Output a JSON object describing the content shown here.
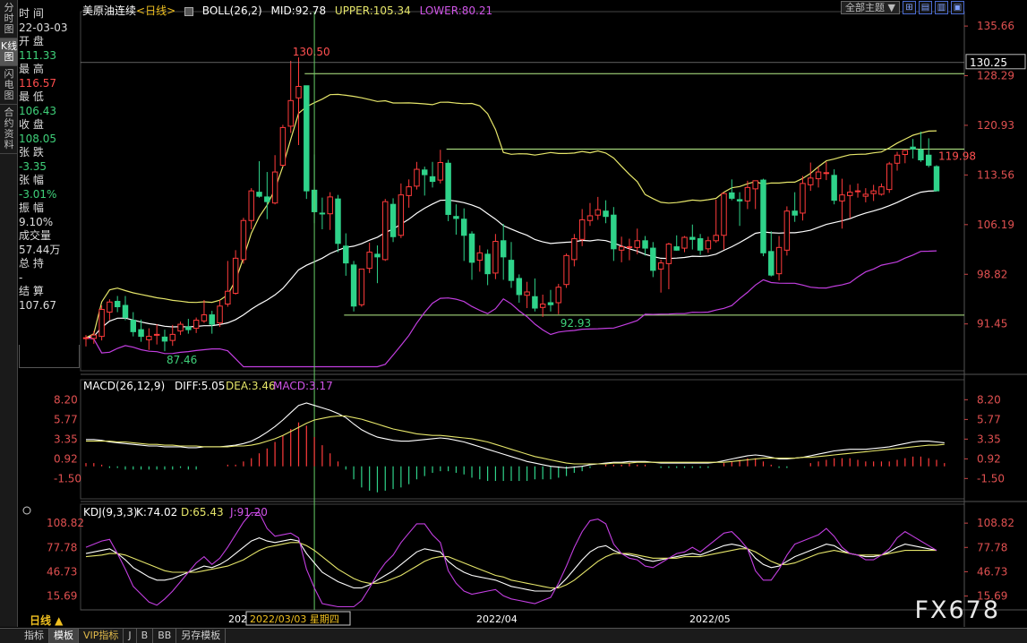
{
  "side_tabs": [
    "分时图",
    "K线图",
    "闪电图",
    "合约资料"
  ],
  "side_active": 1,
  "info_panel": [
    {
      "label": "时 间",
      "value": "22-03-03",
      "color": "white"
    },
    {
      "label": "开 盘",
      "value": "111.33",
      "color": "green"
    },
    {
      "label": "最 高",
      "value": "116.57",
      "color": "red"
    },
    {
      "label": "最 低",
      "value": "106.43",
      "color": "green"
    },
    {
      "label": "收 盘",
      "value": "108.05",
      "color": "green"
    },
    {
      "label": "张 跌",
      "value": "-3.35",
      "color": "green"
    },
    {
      "label": "张 幅",
      "value": "-3.01%",
      "color": "green"
    },
    {
      "label": "振 幅",
      "value": "9.10%",
      "color": "white"
    },
    {
      "label": "成交量",
      "value": "57.44万",
      "color": "white"
    },
    {
      "label": "总 持",
      "value": "-",
      "color": "white"
    },
    {
      "label": "结 算",
      "value": "107.67",
      "color": "white"
    }
  ],
  "header": {
    "symbol": "美原油连续",
    "period_tag": "<日线>",
    "boll_label": "BOLL(26,2)",
    "mid": "MID:92.78",
    "upper": "UPPER:105.34",
    "lower": "LOWER:80.21"
  },
  "toolbar": {
    "theme": "全部主题",
    "icons": [
      "⊞",
      "▤",
      "▥",
      "▣"
    ]
  },
  "macd_header": {
    "name": "MACD(26,12,9)",
    "diff": "DIFF:5.05",
    "dea": "DEA:3.46",
    "macd": "MACD:3.17"
  },
  "kdj_header": {
    "name": "KDJ(9,3,3)",
    "k": "K:74.02",
    "d": "D:65.43",
    "j": "J:91.20"
  },
  "period_button": "日线 ▲",
  "date_axis": {
    "left": "202",
    "cursor": "2022/03/03 星期四",
    "apr": "2022/04",
    "may": "2022/05"
  },
  "bottom_tabs": [
    "指标",
    "模板",
    "VIP指标",
    "J",
    "B",
    "BB",
    "另存模板"
  ],
  "bottom_active": 1,
  "watermark": "FX678",
  "colors": {
    "up": "#ff3b3b",
    "down": "#2fd38a",
    "mid": "#ffffff",
    "upper": "#e6e66a",
    "lower": "#c23ee0",
    "crosshair": "#66cc66"
  },
  "chart_data": [
    {
      "type": "candlestick",
      "title": "美原油连续 日线",
      "y_ticks": [
        135.66,
        128.29,
        120.93,
        113.56,
        106.19,
        98.82,
        91.45
      ],
      "ylim": [
        84.5,
        137.8
      ],
      "price_tag": "130.25",
      "annotations": [
        {
          "text": "130.50",
          "bar": 26
        },
        {
          "text": "87.46",
          "bar": 10
        },
        {
          "text": "92.93",
          "bar": 60
        },
        {
          "text": "119.98",
          "bar": 108
        }
      ],
      "horizontal_lines": [
        {
          "y": 128.6,
          "from_bar": 28
        },
        {
          "y": 117.4,
          "from_bar": 46
        },
        {
          "y": 92.75,
          "from_bar": 33
        }
      ],
      "ohlc": [
        [
          89.4,
          89.8,
          88.1,
          89.4
        ],
        [
          89.3,
          90.4,
          88.5,
          89.8
        ],
        [
          89.6,
          94.2,
          89.0,
          93.6
        ],
        [
          93.2,
          95.1,
          92.0,
          94.7
        ],
        [
          94.8,
          95.6,
          93.2,
          94.0
        ],
        [
          94.2,
          95.6,
          92.0,
          92.4
        ],
        [
          92.0,
          93.2,
          89.6,
          90.3
        ],
        [
          90.6,
          92.1,
          88.8,
          89.6
        ],
        [
          89.1,
          90.8,
          87.6,
          89.6
        ],
        [
          89.9,
          91.4,
          88.4,
          89.9
        ],
        [
          89.5,
          90.6,
          87.4,
          88.9
        ],
        [
          89.0,
          91.3,
          88.2,
          89.9
        ],
        [
          90.4,
          91.8,
          89.8,
          91.4
        ],
        [
          91.0,
          92.2,
          90.0,
          90.6
        ],
        [
          90.8,
          92.4,
          90.1,
          92.0
        ],
        [
          91.9,
          95.0,
          91.6,
          92.8
        ],
        [
          92.8,
          93.4,
          90.0,
          91.4
        ],
        [
          91.6,
          95.0,
          91.0,
          94.1
        ],
        [
          94.4,
          100.8,
          94.0,
          96.3
        ],
        [
          96.0,
          102.4,
          95.8,
          101.2
        ],
        [
          101.0,
          107.2,
          100.4,
          106.8
        ],
        [
          106.8,
          111.6,
          105.5,
          111.2
        ],
        [
          111.0,
          115.6,
          110.2,
          110.4
        ],
        [
          110.3,
          114.0,
          107.0,
          109.6
        ],
        [
          109.4,
          116.5,
          109.2,
          114.0
        ],
        [
          115.0,
          121.0,
          114.8,
          120.6
        ],
        [
          120.8,
          130.5,
          119.8,
          124.6
        ],
        [
          125.0,
          131.0,
          118.0,
          126.7
        ],
        [
          126.8,
          126.8,
          110.0,
          111.2
        ],
        [
          111.3,
          116.6,
          106.4,
          108.1
        ],
        [
          107.9,
          110.2,
          105.5,
          107.8
        ],
        [
          107.8,
          111.0,
          105.4,
          110.3
        ],
        [
          110.0,
          110.6,
          102.1,
          103.4
        ],
        [
          103.0,
          104.9,
          98.6,
          100.5
        ],
        [
          100.2,
          100.8,
          93.3,
          94.1
        ],
        [
          94.3,
          99.6,
          94.0,
          99.6
        ],
        [
          99.7,
          103.5,
          99.0,
          102.1
        ],
        [
          101.8,
          103.1,
          97.5,
          101.4
        ],
        [
          101.0,
          110.0,
          100.8,
          109.6
        ],
        [
          109.2,
          110.1,
          103.6,
          104.4
        ],
        [
          104.6,
          112.3,
          104.2,
          110.6
        ],
        [
          110.5,
          112.9,
          108.7,
          111.8
        ],
        [
          111.9,
          115.5,
          111.4,
          114.4
        ],
        [
          114.3,
          114.8,
          110.5,
          113.6
        ],
        [
          113.3,
          115.5,
          111.7,
          112.6
        ],
        [
          112.8,
          117.3,
          112.3,
          115.4
        ],
        [
          115.3,
          115.8,
          106.7,
          107.7
        ],
        [
          107.4,
          109.2,
          104.7,
          107.1
        ],
        [
          107.0,
          108.6,
          100.8,
          104.6
        ],
        [
          104.8,
          105.2,
          98.0,
          100.6
        ],
        [
          100.9,
          103.1,
          99.2,
          102.0
        ],
        [
          101.8,
          102.5,
          97.2,
          98.9
        ],
        [
          99.0,
          104.8,
          98.1,
          103.7
        ],
        [
          103.8,
          106.3,
          98.0,
          101.4
        ],
        [
          100.9,
          103.6,
          96.8,
          97.9
        ],
        [
          98.2,
          98.8,
          94.6,
          95.8
        ],
        [
          95.7,
          97.7,
          93.8,
          96.2
        ],
        [
          95.5,
          98.2,
          93.3,
          93.8
        ],
        [
          93.9,
          95.8,
          92.5,
          94.4
        ],
        [
          94.6,
          96.5,
          93.3,
          94.3
        ],
        [
          94.6,
          97.4,
          92.9,
          96.9
        ],
        [
          97.3,
          101.9,
          96.8,
          101.6
        ],
        [
          101.0,
          104.8,
          100.0,
          104.1
        ],
        [
          104.0,
          108.5,
          103.0,
          106.9
        ],
        [
          106.8,
          109.4,
          106.0,
          107.5
        ],
        [
          107.6,
          110.3,
          106.9,
          108.4
        ],
        [
          108.2,
          109.8,
          106.4,
          107.4
        ],
        [
          107.6,
          108.8,
          100.8,
          102.6
        ],
        [
          102.4,
          104.4,
          100.6,
          102.9
        ],
        [
          102.8,
          104.1,
          100.9,
          102.9
        ],
        [
          102.8,
          105.6,
          101.8,
          103.8
        ],
        [
          103.8,
          104.5,
          101.6,
          102.7
        ],
        [
          102.7,
          103.6,
          98.4,
          99.4
        ],
        [
          99.6,
          101.0,
          96.1,
          100.5
        ],
        [
          100.4,
          103.5,
          96.6,
          103.3
        ],
        [
          102.9,
          104.6,
          102.3,
          102.4
        ],
        [
          102.7,
          104.5,
          102.1,
          104.3
        ],
        [
          104.3,
          106.2,
          102.5,
          104.0
        ],
        [
          104.1,
          104.8,
          101.7,
          102.4
        ],
        [
          102.6,
          104.4,
          102.0,
          103.8
        ],
        [
          103.8,
          109.9,
          103.5,
          104.6
        ],
        [
          104.6,
          111.0,
          102.5,
          110.8
        ],
        [
          110.9,
          112.9,
          109.8,
          110.1
        ],
        [
          109.9,
          111.0,
          106.0,
          109.7
        ],
        [
          109.7,
          112.7,
          108.5,
          111.7
        ],
        [
          111.5,
          112.7,
          108.5,
          112.7
        ],
        [
          112.8,
          113.0,
          101.5,
          102.0
        ],
        [
          102.2,
          105.2,
          98.5,
          98.7
        ],
        [
          98.9,
          104.5,
          97.9,
          102.8
        ],
        [
          102.4,
          108.9,
          101.6,
          108.2
        ],
        [
          108.2,
          111.0,
          106.6,
          107.6
        ],
        [
          107.9,
          113.4,
          106.8,
          112.3
        ],
        [
          112.1,
          115.4,
          111.2,
          113.1
        ],
        [
          113.0,
          114.8,
          111.7,
          114.0
        ],
        [
          113.9,
          115.5,
          112.8,
          113.9
        ],
        [
          113.5,
          114.4,
          109.2,
          109.8
        ],
        [
          109.7,
          113.0,
          105.6,
          110.6
        ],
        [
          110.5,
          112.1,
          107.1,
          111.0
        ],
        [
          111.2,
          112.3,
          110.2,
          111.2
        ],
        [
          110.4,
          111.6,
          109.5,
          110.7
        ],
        [
          110.8,
          112.1,
          109.7,
          111.2
        ],
        [
          110.7,
          112.3,
          110.5,
          111.8
        ],
        [
          111.4,
          115.5,
          110.9,
          115.2
        ],
        [
          115.3,
          117.0,
          114.2,
          116.5
        ],
        [
          116.6,
          117.3,
          115.3,
          117.2
        ],
        [
          117.7,
          118.9,
          116.0,
          117.4
        ],
        [
          117.3,
          120.0,
          115.5,
          115.8
        ],
        [
          116.5,
          119.0,
          114.7,
          115.0
        ],
        [
          114.8,
          115.0,
          111.2,
          111.2
        ]
      ]
    },
    {
      "type": "macd",
      "y_ticks": [
        8.2,
        5.77,
        3.35,
        0.92,
        -1.5
      ],
      "ylim": [
        -4.0,
        10.0
      ],
      "diff": [
        3.3,
        3.3,
        3.2,
        3.0,
        2.9,
        2.8,
        2.7,
        2.6,
        2.5,
        2.5,
        2.4,
        2.4,
        2.4,
        2.3,
        2.3,
        2.4,
        2.4,
        2.4,
        2.5,
        2.6,
        2.8,
        3.1,
        3.6,
        4.2,
        4.9,
        5.7,
        6.6,
        7.5,
        7.8,
        7.5,
        7.2,
        6.9,
        6.5,
        6.0,
        5.2,
        4.5,
        4.0,
        3.6,
        3.4,
        3.2,
        3.1,
        3.1,
        3.2,
        3.3,
        3.4,
        3.5,
        3.4,
        3.2,
        3.0,
        2.7,
        2.4,
        2.1,
        1.8,
        1.5,
        1.2,
        0.9,
        0.6,
        0.4,
        0.2,
        0.0,
        -0.1,
        -0.2,
        -0.1,
        0.0,
        0.2,
        0.3,
        0.4,
        0.5,
        0.5,
        0.6,
        0.6,
        0.6,
        0.5,
        0.4,
        0.4,
        0.4,
        0.4,
        0.4,
        0.4,
        0.4,
        0.5,
        0.7,
        0.9,
        1.1,
        1.3,
        1.4,
        1.3,
        1.1,
        0.9,
        0.9,
        1.0,
        1.1,
        1.3,
        1.5,
        1.7,
        1.9,
        2.0,
        2.1,
        2.1,
        2.1,
        2.2,
        2.3,
        2.4,
        2.6,
        2.8,
        3.0,
        3.1,
        3.1,
        3.0,
        2.9
      ],
      "dea": [
        3.1,
        3.1,
        3.1,
        3.1,
        3.0,
        3.0,
        2.9,
        2.8,
        2.7,
        2.7,
        2.6,
        2.6,
        2.5,
        2.5,
        2.5,
        2.4,
        2.4,
        2.4,
        2.4,
        2.5,
        2.5,
        2.6,
        2.8,
        3.1,
        3.4,
        3.8,
        4.3,
        4.8,
        5.3,
        5.7,
        5.9,
        6.1,
        6.2,
        6.2,
        6.0,
        5.8,
        5.5,
        5.2,
        4.9,
        4.6,
        4.4,
        4.2,
        4.0,
        3.9,
        3.8,
        3.8,
        3.7,
        3.6,
        3.5,
        3.4,
        3.2,
        3.0,
        2.7,
        2.4,
        2.1,
        1.8,
        1.5,
        1.2,
        1.0,
        0.8,
        0.6,
        0.4,
        0.3,
        0.3,
        0.3,
        0.3,
        0.3,
        0.4,
        0.4,
        0.4,
        0.5,
        0.5,
        0.5,
        0.5,
        0.5,
        0.5,
        0.5,
        0.5,
        0.5,
        0.5,
        0.5,
        0.5,
        0.6,
        0.7,
        0.8,
        0.9,
        1.0,
        1.0,
        1.0,
        1.0,
        1.0,
        1.1,
        1.1,
        1.2,
        1.3,
        1.4,
        1.5,
        1.6,
        1.7,
        1.8,
        1.9,
        2.0,
        2.1,
        2.2,
        2.3,
        2.4,
        2.5,
        2.6,
        2.6,
        2.7
      ]
    },
    {
      "type": "kdj",
      "y_ticks": [
        108.82,
        77.78,
        46.73,
        15.69
      ],
      "ylim": [
        -2,
        125
      ],
      "k": [
        70,
        72,
        74,
        76,
        70,
        62,
        52,
        46,
        40,
        36,
        36,
        38,
        42,
        46,
        50,
        54,
        52,
        56,
        62,
        70,
        78,
        86,
        90,
        86,
        84,
        86,
        88,
        86,
        70,
        58,
        46,
        40,
        34,
        30,
        26,
        26,
        30,
        36,
        42,
        48,
        56,
        64,
        72,
        76,
        74,
        72,
        60,
        52,
        46,
        42,
        40,
        38,
        36,
        32,
        28,
        26,
        24,
        22,
        22,
        22,
        28,
        38,
        50,
        62,
        72,
        78,
        80,
        74,
        70,
        68,
        66,
        62,
        60,
        62,
        64,
        66,
        68,
        70,
        68,
        72,
        76,
        80,
        82,
        80,
        76,
        64,
        56,
        52,
        54,
        60,
        66,
        70,
        74,
        78,
        82,
        80,
        74,
        70,
        68,
        66,
        66,
        68,
        72,
        78,
        82,
        80,
        78,
        76,
        74
      ],
      "d": [
        66,
        67,
        68,
        70,
        70,
        68,
        64,
        60,
        56,
        52,
        48,
        46,
        46,
        46,
        46,
        48,
        50,
        52,
        54,
        58,
        62,
        68,
        74,
        78,
        80,
        82,
        84,
        84,
        80,
        74,
        66,
        58,
        50,
        44,
        38,
        34,
        32,
        32,
        34,
        38,
        42,
        48,
        54,
        60,
        64,
        66,
        66,
        62,
        58,
        54,
        50,
        46,
        42,
        40,
        36,
        34,
        32,
        30,
        28,
        26,
        26,
        30,
        36,
        44,
        52,
        60,
        66,
        70,
        70,
        70,
        68,
        66,
        64,
        64,
        64,
        64,
        66,
        66,
        66,
        68,
        70,
        72,
        74,
        76,
        76,
        72,
        66,
        60,
        56,
        56,
        58,
        62,
        66,
        70,
        72,
        74,
        72,
        70,
        68,
        68,
        68,
        68,
        70,
        72,
        74,
        74,
        74,
        74,
        74
      ],
      "j": [
        78,
        82,
        86,
        88,
        70,
        50,
        28,
        18,
        8,
        4,
        12,
        22,
        34,
        46,
        58,
        66,
        56,
        64,
        78,
        94,
        110,
        122,
        122,
        102,
        92,
        94,
        96,
        90,
        50,
        26,
        6,
        4,
        2,
        2,
        2,
        10,
        26,
        44,
        58,
        68,
        84,
        96,
        108,
        108,
        94,
        84,
        48,
        32,
        22,
        18,
        20,
        22,
        24,
        16,
        12,
        10,
        8,
        6,
        10,
        14,
        32,
        54,
        78,
        98,
        112,
        114,
        108,
        82,
        70,
        64,
        62,
        54,
        52,
        58,
        64,
        70,
        72,
        78,
        72,
        80,
        88,
        96,
        98,
        88,
        76,
        48,
        36,
        36,
        50,
        68,
        82,
        86,
        90,
        94,
        102,
        92,
        78,
        70,
        68,
        62,
        62,
        68,
        76,
        90,
        98,
        92,
        86,
        80,
        74
      ]
    }
  ]
}
